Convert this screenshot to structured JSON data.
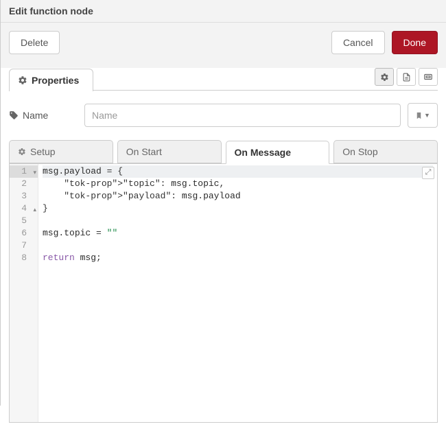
{
  "header": {
    "title": "Edit function node"
  },
  "buttons": {
    "delete": "Delete",
    "cancel": "Cancel",
    "done": "Done"
  },
  "propertiesTab": {
    "label": "Properties"
  },
  "nameRow": {
    "label": "Name",
    "placeholder": "Name",
    "value": ""
  },
  "codeTabs": {
    "setup": "Setup",
    "onStart": "On Start",
    "onMessage": "On Message",
    "onStop": "On Stop",
    "active": "onMessage"
  },
  "editor": {
    "lines": [
      "msg.payload = {",
      "    \"topic\": msg.topic,",
      "    \"payload\": msg.payload",
      "}",
      "",
      "msg.topic = \"\"",
      "",
      "return msg;"
    ],
    "folds": {
      "1": "open",
      "4": "close"
    },
    "activeLine": 1
  }
}
